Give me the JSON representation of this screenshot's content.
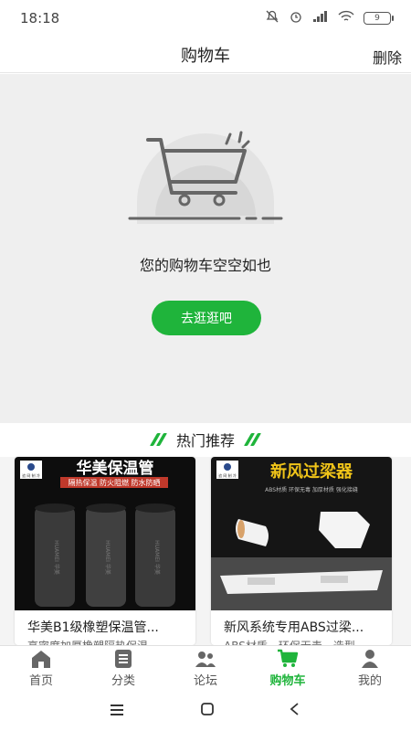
{
  "status": {
    "time": "18:18",
    "battery": "9"
  },
  "header": {
    "title": "购物车",
    "delete_label": "删除"
  },
  "empty_cart": {
    "message": "您的购物车空空如也",
    "button_label": "去逛逛吧"
  },
  "hot": {
    "title": "热门推荐"
  },
  "products": [
    {
      "image_badge": "追 网 制 冷",
      "image_heading": "华美保温管",
      "image_tagline": "隔热保温 防火阻燃 防水防晒",
      "image_brand": "HUAMEI 华美",
      "title": "华美B1级橡塑保温管...",
      "subtitle": "高密度加厚橡塑隔热保温"
    },
    {
      "image_badge": "追 网 制 冷",
      "image_heading": "新风过梁器",
      "image_tagline": "ABS材质 环保无毒 加厚材质 强化接缝",
      "title": "新风系统专用ABS过梁...",
      "subtitle": "ABS材质，环保无毒，造型"
    }
  ],
  "tabs": [
    {
      "label": "首页",
      "icon": "home-icon"
    },
    {
      "label": "分类",
      "icon": "list-icon"
    },
    {
      "label": "论坛",
      "icon": "people-icon"
    },
    {
      "label": "购物车",
      "icon": "cart-icon"
    },
    {
      "label": "我的",
      "icon": "user-icon"
    }
  ],
  "active_tab": "购物车",
  "colors": {
    "accent": "#1fb43b",
    "empty_bg": "#efefef"
  }
}
